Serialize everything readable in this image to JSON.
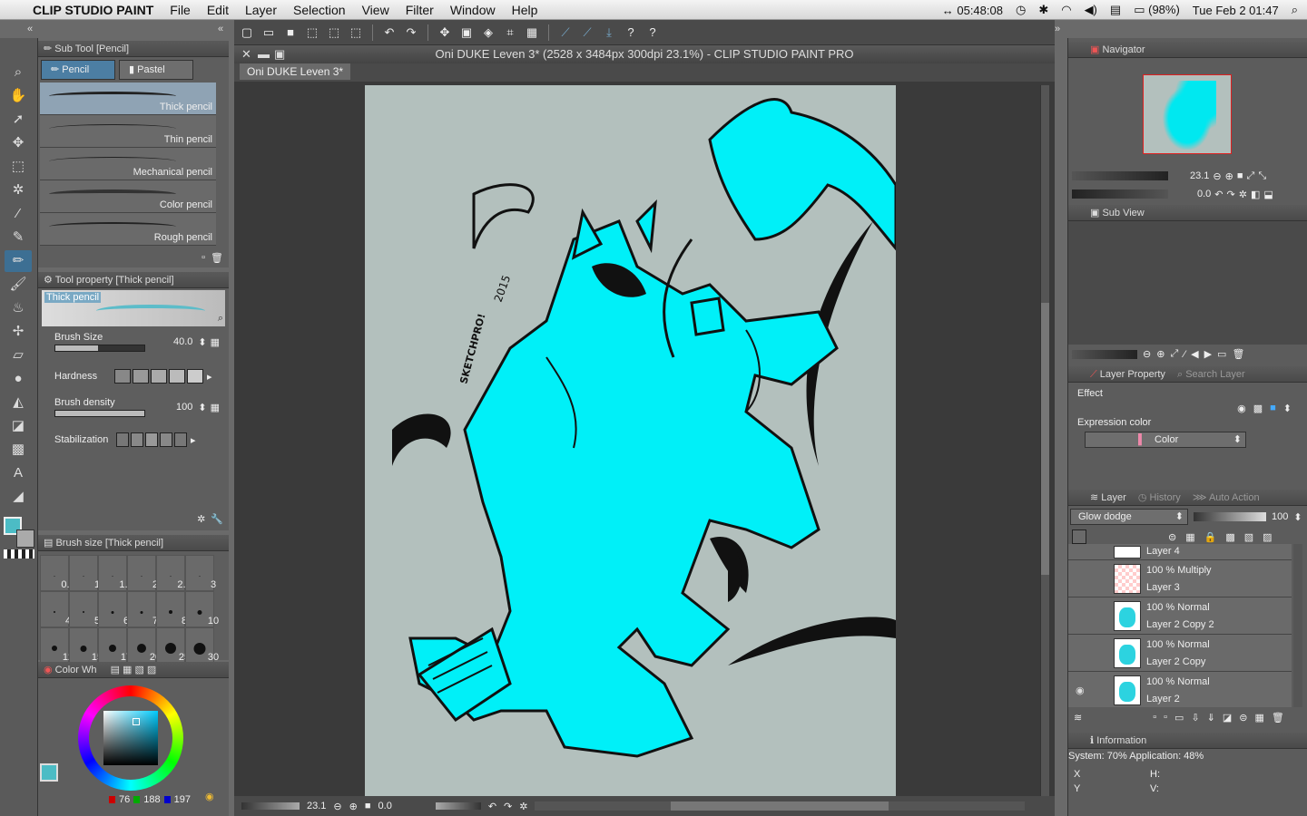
{
  "menubar": {
    "app_name": "CLIP STUDIO PAINT",
    "items": [
      "File",
      "Edit",
      "Layer",
      "Selection",
      "View",
      "Filter",
      "Window",
      "Help"
    ],
    "status_time_elapsed": "05:48:08",
    "battery": "(98%)",
    "clock": "Tue Feb 2  01:47"
  },
  "window": {
    "title": "Oni DUKE Leven 3* (2528 x 3484px 300dpi 23.1%)  - CLIP STUDIO PAINT PRO",
    "tab": "Oni DUKE Leven 3*"
  },
  "subtool": {
    "header": "Sub Tool [Pencil]",
    "tabs": [
      "Pencil",
      "Pastel"
    ],
    "brushes": [
      "Thick pencil",
      "Thin pencil",
      "Mechanical pencil",
      "Color pencil",
      "Rough pencil"
    ]
  },
  "toolprop": {
    "header": "Tool property [Thick pencil]",
    "preview_label": "Thick pencil",
    "brush_size_label": "Brush Size",
    "brush_size_value": "40.0",
    "hardness_label": "Hardness",
    "density_label": "Brush density",
    "density_value": "100",
    "stabilization_label": "Stabilization"
  },
  "brushsize": {
    "header": "Brush size [Thick pencil]",
    "sizes": [
      "0.7",
      "1",
      "1.5",
      "2",
      "2.5",
      "3",
      "4",
      "5",
      "6",
      "7",
      "8",
      "10",
      "12",
      "15",
      "17",
      "20",
      "25",
      "30"
    ]
  },
  "colorwheel": {
    "header": "Color Wh",
    "r": "76",
    "g": "188",
    "b": "197",
    "main_color": "#4cbcc5"
  },
  "canvas": {
    "zoom": "23.1",
    "rotation": "0.0",
    "signature": "2015",
    "tag": "SKETCHPRO!"
  },
  "navigator": {
    "header": "Navigator",
    "zoom": "23.1",
    "rotation": "0.0"
  },
  "subview": {
    "header": "Sub View"
  },
  "layerprop": {
    "tab1": "Layer Property",
    "tab2": "Search Layer",
    "effect_label": "Effect",
    "expr_label": "Expression color",
    "expr_value": "Color"
  },
  "layers": {
    "tabs": [
      "Layer",
      "History",
      "Auto Action"
    ],
    "blend": "Glow dodge",
    "opacity": "100",
    "rows": [
      {
        "mode": "",
        "name": "Layer 4"
      },
      {
        "mode": "100 % Multiply",
        "name": "Layer 3"
      },
      {
        "mode": "100 % Normal",
        "name": "Layer 2 Copy 2"
      },
      {
        "mode": "100 % Normal",
        "name": "Layer 2 Copy"
      },
      {
        "mode": "100 % Normal",
        "name": "Layer 2"
      }
    ]
  },
  "info": {
    "header": "Information",
    "system": "System: 70% Application: 48%",
    "x": "X",
    "y": "Y",
    "h": "H:",
    "v": "V:"
  }
}
